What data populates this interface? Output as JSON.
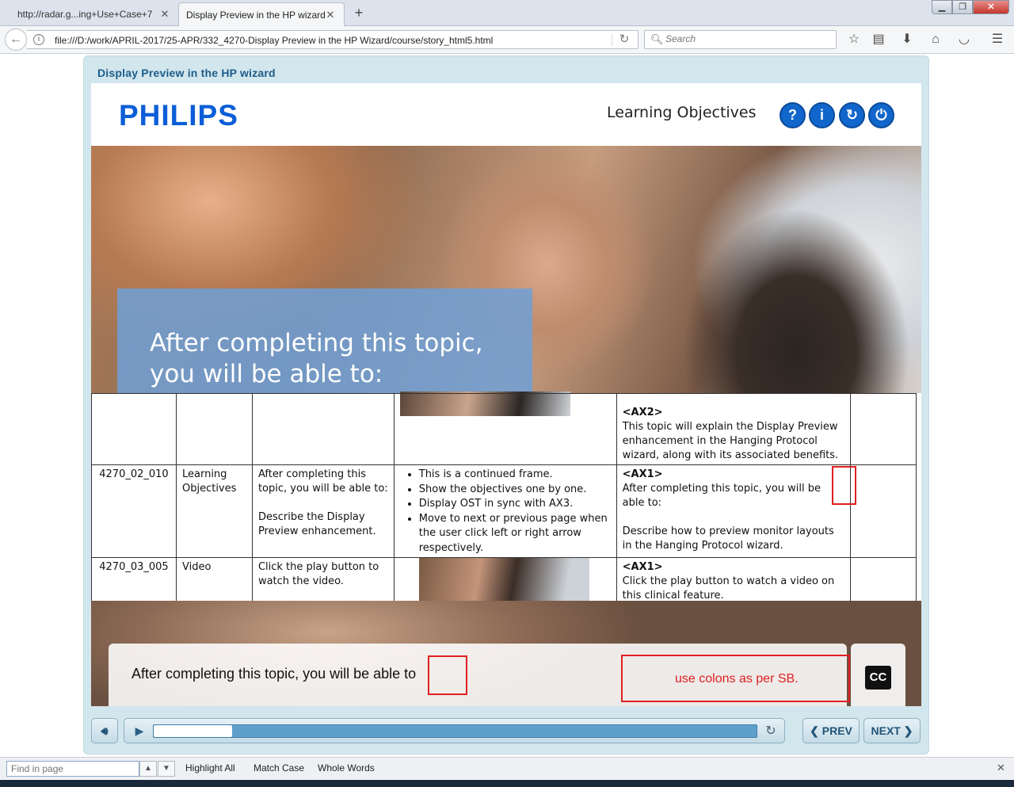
{
  "browser": {
    "tabs": [
      {
        "label": "http://radar.g...ing+Use+Case+7",
        "active": false
      },
      {
        "label": "Display Preview in the HP wizard",
        "active": true
      }
    ],
    "url": "file:///D:/work/APRIL-2017/25-APR/332_4270-Display Preview in the HP Wizard/course/story_html5.html",
    "search_placeholder": "Search"
  },
  "course": {
    "title": "Display Preview in the HP wizard",
    "logo": "PHILIPS",
    "slide_heading": "Learning Objectives",
    "header_buttons": [
      "?",
      "i",
      "↻",
      "⏻"
    ],
    "overlay_text": "After completing this topic, you will be able to:",
    "caption": "After completing this topic, you will be able to",
    "cc_label": "CC",
    "annotation_note": "use colons as per SB.",
    "controls": {
      "prev_label": "PREV",
      "next_label": "NEXT",
      "progress": 0.13
    }
  },
  "storyboard": {
    "rows": [
      {
        "id": "",
        "title": "",
        "ost": "",
        "instructions": [],
        "audio_tag": "<AX2>",
        "audio_text": "This topic will explain the Display Preview enhancement in the Hanging Protocol wizard, along with its associated benefits."
      },
      {
        "id": "4270_02_010",
        "title": "Learning Objectives",
        "ost": "After completing this topic, you will be able to:",
        "ost2": "Describe the Display Preview enhancement.",
        "instructions": [
          "This is a continued frame.",
          "Show the objectives one by one.",
          "Display OST in sync with AX3.",
          "Move to next or previous page when the user click left or right arrow respectively."
        ],
        "audio_tag": "<AX1>",
        "audio_text": "After completing this topic, you will be able to:",
        "audio_text2": "Describe how to preview monitor layouts in the Hanging Protocol wizard."
      },
      {
        "id": "4270_03_005",
        "title": "Video",
        "ost": "Click the play button to watch the video.",
        "instructions": [],
        "audio_tag": "<AX1>",
        "audio_text": "Click the play button to watch a video on this clinical feature."
      }
    ]
  },
  "findbar": {
    "placeholder": "Find in page",
    "highlight_all": "Highlight All",
    "match_case": "Match Case",
    "whole_words": "Whole Words"
  }
}
